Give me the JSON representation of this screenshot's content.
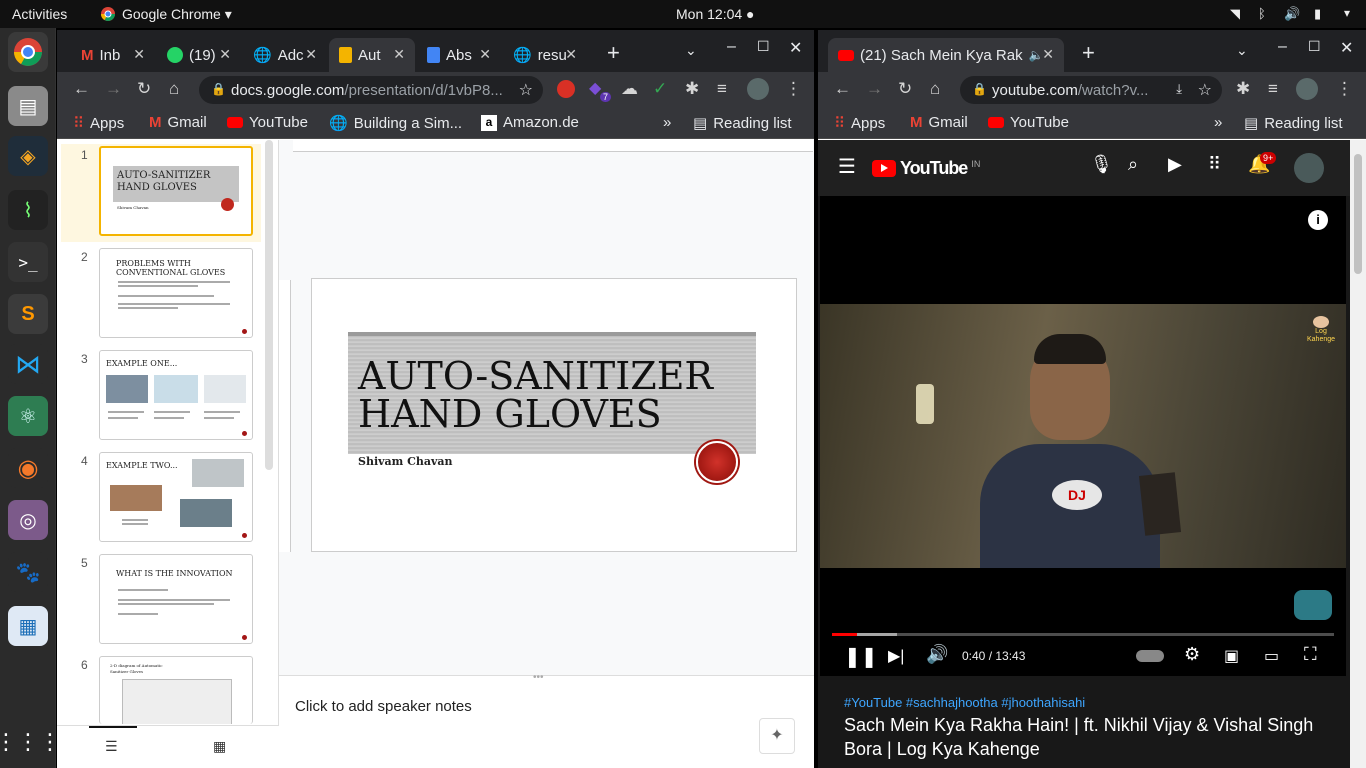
{
  "topbar": {
    "activities": "Activities",
    "app": "Google Chrome",
    "clock": "Mon 12:04"
  },
  "left_window": {
    "tabs": [
      {
        "label": "Inb",
        "icon": "gmail-icon"
      },
      {
        "label": "(19)",
        "icon": "whatsapp-icon"
      },
      {
        "label": "Adc",
        "icon": "globe-icon"
      },
      {
        "label": "Aut",
        "icon": "slides-icon",
        "active": true
      },
      {
        "label": "Abs",
        "icon": "docs-icon"
      },
      {
        "label": "resu",
        "icon": "globe-icon"
      }
    ],
    "url_host": "docs.google.com",
    "url_path": "/presentation/d/1vbP8...",
    "extension_badge": "7",
    "bookmarks": [
      "Apps",
      "Gmail",
      "YouTube",
      "Building a Sim...",
      "Amazon.de"
    ],
    "reading_list": "Reading list",
    "slides": [
      {
        "num": "1",
        "title": "AUTO-SANITIZER HAND GLOVES",
        "subtitle": "Shivam Chavan"
      },
      {
        "num": "2",
        "title": "PROBLEMS WITH CONVENTIONAL GLOVES"
      },
      {
        "num": "3",
        "title": "EXAMPLE ONE..."
      },
      {
        "num": "4",
        "title": "EXAMPLE TWO..."
      },
      {
        "num": "5",
        "title": "WHAT IS THE INNOVATION"
      },
      {
        "num": "6",
        "title": "2-D diagram of Automatic Sanitizer Gloves"
      }
    ],
    "main_slide": {
      "title_line1": "AUTO-SANITIZER",
      "title_line2": "HAND GLOVES",
      "author": "Shivam Chavan"
    },
    "speaker_notes": "Click to add speaker notes"
  },
  "right_window": {
    "tab_title": "(21) Sach Mein Kya Rak",
    "url_host": "youtube.com",
    "url_path": "/watch?v...",
    "bookmarks": [
      "Apps",
      "Gmail",
      "YouTube"
    ],
    "reading_list": "Reading list",
    "youtube": {
      "logo": "YouTube",
      "country": "IN",
      "notifications": "9+"
    },
    "player": {
      "time": "0:40 / 13:43",
      "progress_fraction": 0.049,
      "buffered_fraction": 0.13,
      "watermark": "Log Kahenge"
    },
    "video": {
      "hashtags": "#YouTube #sachhajhootha #jhoothahisahi",
      "title_line1": "Sach Mein Kya Rakha Hain! | ft. Nikhil Vijay & Vishal Singh",
      "title_line2": "Bora | Log Kya Kahenge"
    }
  },
  "colors": {
    "youtube_red": "#ff0000",
    "slides_yellow": "#f4b400",
    "chrome_dark": "#202124"
  }
}
